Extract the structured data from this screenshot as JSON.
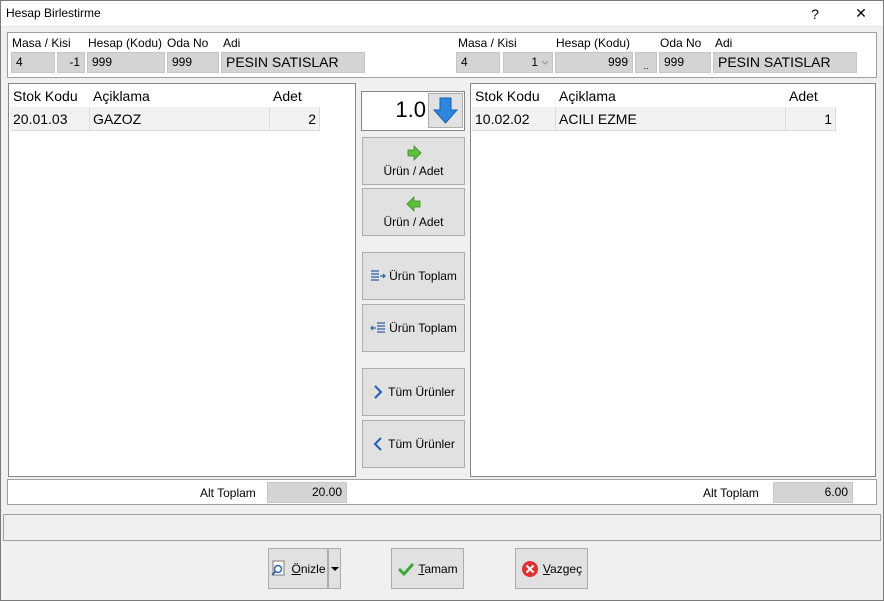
{
  "window": {
    "title": "Hesap Birlestirme",
    "help_glyph": "?",
    "close_glyph": "✕"
  },
  "left": {
    "labels": {
      "masa_kisi": "Masa / Kisi",
      "hesap_kodu": "Hesap (Kodu)",
      "oda_no": "Oda No",
      "adi": "Adi"
    },
    "masa": "4",
    "kisi": "-1",
    "hesap_kodu": "999",
    "oda_no": "999",
    "adi": "PESIN SATISLAR",
    "grid": {
      "headers": [
        "Stok Kodu",
        "Açiklama",
        "Adet"
      ],
      "rows": [
        {
          "stok_kodu": "20.01.03",
          "aciklama": "GAZOZ",
          "adet": "2"
        }
      ]
    },
    "alt_toplam_label": "Alt Toplam",
    "alt_toplam": "20.00"
  },
  "right": {
    "labels": {
      "masa_kisi": "Masa / Kisi",
      "hesap_kodu": "Hesap (Kodu)",
      "oda_no": "Oda No",
      "adi": "Adi"
    },
    "masa": "4",
    "kisi": "1",
    "hesap_kodu": "999",
    "lookup_glyph": "..",
    "oda_no": "999",
    "adi": "PESIN SATISLAR",
    "grid": {
      "headers": [
        "Stok Kodu",
        "Açiklama",
        "Adet"
      ],
      "rows": [
        {
          "stok_kodu": "10.02.02",
          "aciklama": "ACILI EZME",
          "adet": "1"
        }
      ]
    },
    "alt_toplam_label": "Alt Toplam",
    "alt_toplam": "6.00"
  },
  "middle": {
    "quantity": "1.0",
    "buttons": {
      "move_right_item": "Ürün / Adet",
      "move_left_item": "Ürün / Adet",
      "move_right_total": "Ürün Toplam",
      "move_left_total": "Ürün Toplam",
      "move_right_all": "Tüm Ürünler",
      "move_left_all": "Tüm Ürünler"
    }
  },
  "footer": {
    "preview": {
      "hot": "Ö",
      "rest": "nizle"
    },
    "ok": {
      "hot": "T",
      "rest": "amam"
    },
    "cancel": {
      "hot": "V",
      "rest": "azgeç"
    }
  },
  "colors": {
    "arrow_green": "#5cc13a",
    "arrow_blue": "#2e86de",
    "cancel_red": "#e03030",
    "check_green": "#3aaa35"
  }
}
